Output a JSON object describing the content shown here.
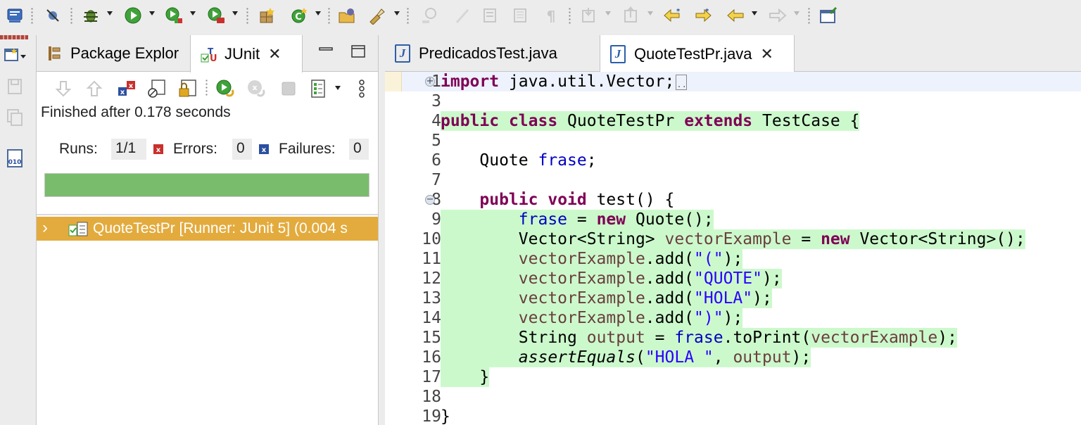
{
  "toolbar": {
    "icons": [
      "console-icon",
      "skip-breakpoints-icon",
      "debug-icon",
      "run-icon",
      "run-coverage-icon",
      "external-tools-icon",
      "new-package-icon",
      "new-class-icon",
      "open-type-icon",
      "search-icon",
      "disabled-toggle-icon",
      "disabled-markers-icon",
      "disabled-block-icon",
      "disabled-whitespace-icon",
      "disabled-pilcrow-icon",
      "next-annotation-icon",
      "previous-annotation-icon",
      "last-edit-icon",
      "forward-edit-icon",
      "back-icon",
      "forward-icon",
      "open-perspective-icon"
    ]
  },
  "junit_view": {
    "tabs": [
      {
        "label": "Package Explor"
      },
      {
        "label": "JUnit",
        "active": true
      }
    ],
    "finished_text": "Finished after 0.178 seconds",
    "runs_label": "Runs:",
    "runs_value": "1/1",
    "errors_label": "Errors:",
    "errors_value": "0",
    "failures_label": "Failures:",
    "failures_value": "0",
    "progress_fraction": 1.0,
    "progress_color": "#79bc6b",
    "test_row_label": "QuoteTestPr [Runner: JUnit 5] (0.004 s",
    "test_row_color": "#e3ab3d"
  },
  "editor": {
    "tabs": [
      {
        "label": "PredicadosTest.java"
      },
      {
        "label": "QuoteTestPr.java",
        "active": true
      }
    ],
    "line_numbers": [
      "1",
      "3",
      "4",
      "5",
      "6",
      "7",
      "8",
      "9",
      "10",
      "11",
      "12",
      "13",
      "14",
      "15",
      "16",
      "17",
      "18",
      "19"
    ],
    "code": {
      "l1_kw": "import",
      "l1_rest": " java.util.Vector;",
      "l4_public": "public",
      "l4_class": "class",
      "l4_name": " QuoteTestPr ",
      "l4_extends": "extends",
      "l4_rest": " TestCase {",
      "l6_type": "    Quote ",
      "l6_field": "frase",
      "l6_end": ";",
      "l8_public": "public",
      "l8_void": "void",
      "l8_rest": " test() {",
      "l9_field": "frase",
      "l9_eq": " = ",
      "l9_new": "new",
      "l9_rest": " Quote();",
      "l10_type": "Vector<String> ",
      "l10_var": "vectorExample",
      "l10_eq": " = ",
      "l10_new": "new",
      "l10_rest": " Vector<String>();",
      "l11_var": "vectorExample",
      "l11_call": ".add(",
      "l11_str": "\"(\"",
      "l11_end": ");",
      "l12_var": "vectorExample",
      "l12_call": ".add(",
      "l12_str": "\"QUOTE\"",
      "l12_end": ");",
      "l13_var": "vectorExample",
      "l13_call": ".add(",
      "l13_str": "\"HOLA\"",
      "l13_end": ");",
      "l14_var": "vectorExample",
      "l14_call": ".add(",
      "l14_str": "\")\"",
      "l14_end": ");",
      "l15_type": "String ",
      "l15_var": "output",
      "l15_eq": " = ",
      "l15_field": "frase",
      "l15_call": ".toPrint(",
      "l15_arg": "vectorExample",
      "l15_end": ");",
      "l16_method": "assertEquals",
      "l16_open": "(",
      "l16_str": "\"HOLA \"",
      "l16_comma": ", ",
      "l16_arg": "output",
      "l16_end": ");",
      "l17": "}",
      "l19": "}"
    },
    "highlight_color": "#ccf9cc"
  }
}
